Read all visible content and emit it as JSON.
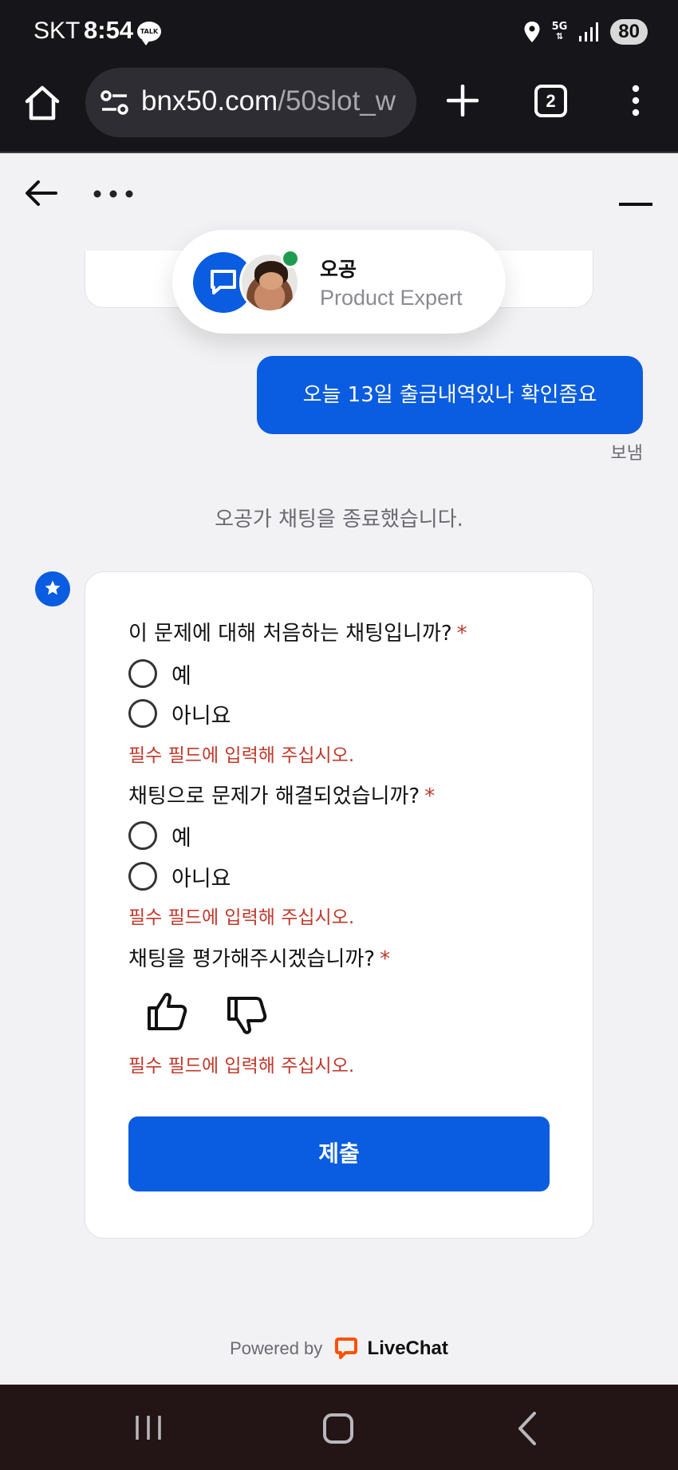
{
  "status_bar": {
    "carrier": "SKT",
    "time": "8:54",
    "talk_badge": "TALK",
    "network": "5G",
    "battery": "80",
    "icons": [
      "location-icon",
      "signal-icon"
    ]
  },
  "browser": {
    "url_host": "bnx50.com",
    "url_path": "/50slot_w",
    "tab_count": "2",
    "icons": [
      "home-icon",
      "tune-icon",
      "plus-icon",
      "tabs-icon",
      "more-vert-icon"
    ]
  },
  "chat": {
    "agent": {
      "name": "오공",
      "role": "Product Expert",
      "online_color": "#1f9b4f"
    },
    "message": {
      "text": "오늘 13일 출금내역있나 확인좀요",
      "status": "보냄"
    },
    "system_message": "오공가 채팅을 종료했습니다.",
    "survey": {
      "questions": [
        {
          "label": "이 문제에 대해 처음하는 채팅입니까?",
          "required_mark": "*",
          "options": [
            "예",
            "아니요"
          ],
          "error": "필수 필드에 입력해 주십시오."
        },
        {
          "label": "채팅으로 문제가 해결되었습니까?",
          "required_mark": "*",
          "options": [
            "예",
            "아니요"
          ],
          "error": "필수 필드에 입력해 주십시오."
        },
        {
          "label": "채팅을 평가해주시겠습니까?",
          "required_mark": "*",
          "rating_icons": [
            "thumbs-up-icon",
            "thumbs-down-icon"
          ],
          "error": "필수 필드에 입력해 주십시오."
        }
      ],
      "submit_label": "제출"
    },
    "powered_by": "Powered by",
    "brand": "LiveChat"
  },
  "colors": {
    "accent": "#0a5ce0",
    "error": "#c0392b",
    "brand_orange": "#ff5100"
  }
}
